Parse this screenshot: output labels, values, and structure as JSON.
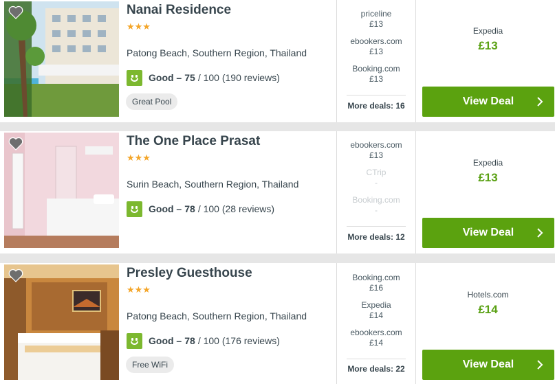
{
  "colors": {
    "accent": "#5ba20f",
    "price": "#5aa114",
    "stars": "#f4a62a",
    "rating_icon": "#7cb82f"
  },
  "hotels": [
    {
      "name": "Nanai Residence",
      "stars": "★★★",
      "location": "Patong Beach, Southern Region, Thailand",
      "rating_word": "Good –",
      "rating_score": "75",
      "rating_rest": "/ 100 (190 reviews)",
      "tag": "Great Pool",
      "deals": [
        {
          "provider": "priceline",
          "price": "£13"
        },
        {
          "provider": "ebookers.com",
          "price": "£13"
        },
        {
          "provider": "Booking.com",
          "price": "£13"
        }
      ],
      "more_deals": "More deals: 16",
      "best_provider": "Expedia",
      "best_price": "£13",
      "button": "View Deal"
    },
    {
      "name": "The One Place Prasat",
      "stars": "★★★",
      "location": "Surin Beach, Southern Region, Thailand",
      "rating_word": "Good –",
      "rating_score": "78",
      "rating_rest": "/ 100 (28 reviews)",
      "tag": "",
      "deals": [
        {
          "provider": "ebookers.com",
          "price": "£13"
        },
        {
          "provider": "CTrip",
          "price": "-"
        },
        {
          "provider": "Booking.com",
          "price": "-"
        }
      ],
      "more_deals": "More deals: 12",
      "best_provider": "Expedia",
      "best_price": "£13",
      "button": "View Deal"
    },
    {
      "name": "Presley Guesthouse",
      "stars": "★★★",
      "location": "Patong Beach, Southern Region, Thailand",
      "rating_word": "Good –",
      "rating_score": "78",
      "rating_rest": "/ 100 (176 reviews)",
      "tag": "Free WiFi",
      "deals": [
        {
          "provider": "Booking.com",
          "price": "£16"
        },
        {
          "provider": "Expedia",
          "price": "£14"
        },
        {
          "provider": "ebookers.com",
          "price": "£14"
        }
      ],
      "more_deals": "More deals: 22",
      "best_provider": "Hotels.com",
      "best_price": "£14",
      "button": "View Deal"
    }
  ]
}
